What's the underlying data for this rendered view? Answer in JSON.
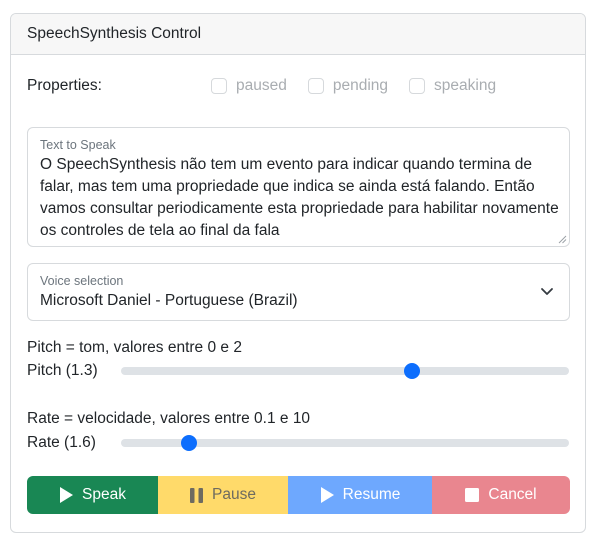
{
  "card": {
    "title": "SpeechSynthesis Control"
  },
  "properties": {
    "label": "Properties:",
    "checks": [
      {
        "label": "paused",
        "checked": false
      },
      {
        "label": "pending",
        "checked": false
      },
      {
        "label": "speaking",
        "checked": false
      }
    ]
  },
  "text_to_speak": {
    "label": "Text to Speak",
    "value": "O SpeechSynthesis não tem um evento para indicar quando termina de falar, mas tem uma propriedade que indica se ainda está falando. Então vamos consultar periodicamente esta propriedade para habilitar novamente os controles de tela ao final da fala"
  },
  "voice": {
    "label": "Voice selection",
    "selected": "Microsoft Daniel - Portuguese (Brazil)"
  },
  "pitch": {
    "title": "Pitch = tom, valores entre 0 e 2",
    "label": "Pitch (1.3)",
    "value": 1.3,
    "min": 0,
    "max": 2
  },
  "rate": {
    "title": "Rate = velocidade, valores entre 0.1 e 10",
    "label": "Rate (1.6)",
    "value": 1.6,
    "min": 0.1,
    "max": 10
  },
  "buttons": {
    "speak": "Speak",
    "pause": "Pause",
    "resume": "Resume",
    "cancel": "Cancel"
  },
  "colors": {
    "speak": "#198754",
    "pause": "#ffda6a",
    "resume": "#6ea8fe",
    "cancel": "#e9868f",
    "slider_thumb": "#0d6efd"
  }
}
